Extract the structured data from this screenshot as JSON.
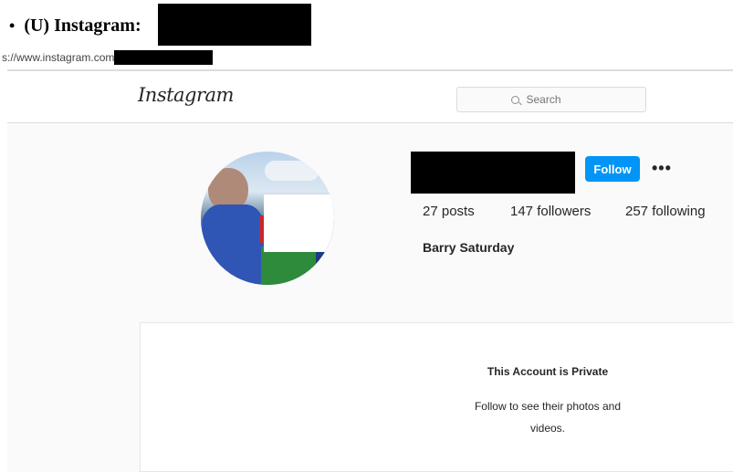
{
  "document": {
    "bullet": "•",
    "heading": "(U) Instagram:",
    "url_prefix": "s://www.instagram.com"
  },
  "instagram": {
    "logo": "Instagram",
    "search": {
      "placeholder": "Search"
    },
    "profile": {
      "follow_label": "Follow",
      "more_options": "•••",
      "stats": {
        "posts_count": "27",
        "posts_label": "posts",
        "followers_count": "147",
        "followers_label": "followers",
        "following_count": "257",
        "following_label": "following"
      },
      "full_name": "Barry Saturday"
    },
    "private_notice": {
      "title": "This Account is Private",
      "line1": "Follow to see their photos and",
      "line2": "videos."
    }
  },
  "colors": {
    "follow_button": "#0095f6",
    "page_background": "#fafafa",
    "redaction": "#000000"
  }
}
